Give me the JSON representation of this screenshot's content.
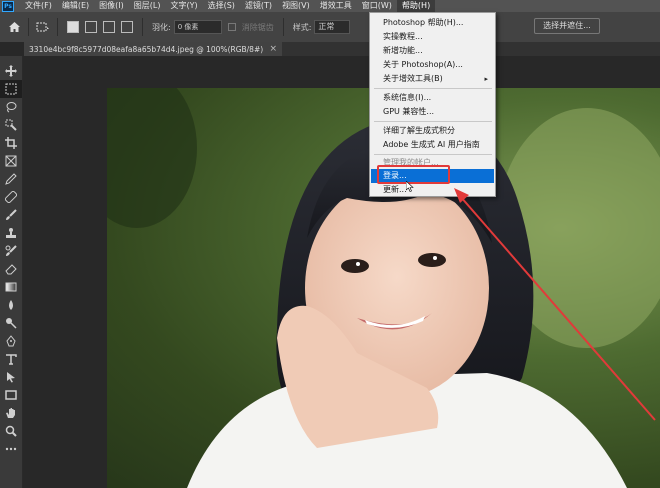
{
  "app": {
    "logo": "Ps"
  },
  "menubar": {
    "items": [
      "文件(F)",
      "编辑(E)",
      "图像(I)",
      "图层(L)",
      "文字(Y)",
      "选择(S)",
      "滤镜(T)",
      "视图(V)",
      "增效工具",
      "窗口(W)",
      "帮助(H)"
    ]
  },
  "options": {
    "feather_label": "羽化:",
    "feather_value": "0 像素",
    "antialias_label": "消除锯齿",
    "style_label": "样式:",
    "style_value": "正常",
    "select_subject": "选择并遮住..."
  },
  "document_tab": {
    "title": "3310e4bc9f8c5977d08eafa8a65b74d4.jpeg @ 100%(RGB/8#)",
    "close": "×"
  },
  "help_menu": {
    "items": [
      {
        "label": "Photoshop 帮助(H)..."
      },
      {
        "label": "实操教程..."
      },
      {
        "label": "新增功能..."
      },
      {
        "label": "关于 Photoshop(A)..."
      },
      {
        "label": "关于增效工具(B)",
        "submenu": "▸"
      },
      {
        "label": "系统信息(I)..."
      },
      {
        "label": "GPU 兼容性..."
      },
      {
        "label": "详细了解生成式积分"
      },
      {
        "label": "Adobe 生成式 AI 用户指南"
      },
      {
        "label": "管理我的帐户..."
      },
      {
        "label": "登录..."
      },
      {
        "label": "更新..."
      }
    ]
  },
  "colors": {
    "accent": "#0a6fd6",
    "annotation": "#e13a3a"
  },
  "icons": [
    "home-icon",
    "marquee-icon",
    "move-icon",
    "lasso-icon",
    "quick-select-icon",
    "crop-icon",
    "frame-icon",
    "eyedropper-icon",
    "healing-icon",
    "brush-icon",
    "clone-stamp-icon",
    "history-brush-icon",
    "eraser-icon",
    "gradient-icon",
    "blur-icon",
    "dodge-icon",
    "pen-icon",
    "type-icon",
    "path-select-icon",
    "rectangle-icon",
    "hand-icon",
    "zoom-icon",
    "more-icon"
  ]
}
